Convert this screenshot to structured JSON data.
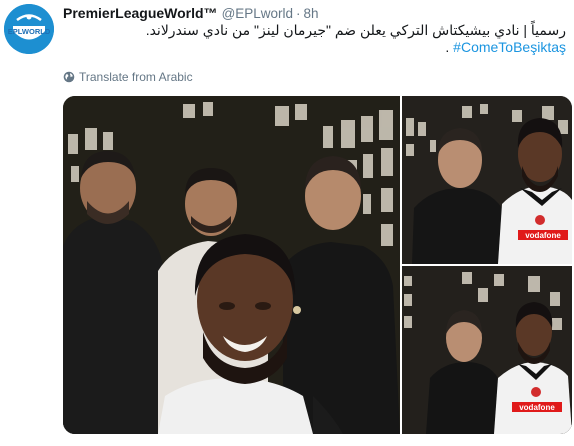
{
  "tweet": {
    "display_name": "PremierLeagueWorld™",
    "handle": "@EPLworld",
    "separator": "·",
    "time": "8h",
    "text_line1": "رسمياً | نادي بيشيكتاش التركي يعلن ضم \"جيرمان لينز\" من نادي سندرلاند.",
    "text_line2_hashtag": "#ComeToBeşiktaş",
    "text_line2_end": " .",
    "translate_label": "Translate from Arabic",
    "avatar_logo_text": "EPLWORLD"
  },
  "icons": {
    "avatar": "epl-world-logo",
    "translate": "globe-icon"
  },
  "media": {
    "photos": [
      {
        "name": "group-selfie-photo"
      },
      {
        "name": "jersey-photo-top"
      },
      {
        "name": "jersey-photo-bottom"
      }
    ],
    "jersey_sponsor": "vodafone"
  },
  "colors": {
    "accent": "#1b95e0",
    "secondary_text": "#657786",
    "avatar_bg": "#1d8fd1"
  }
}
